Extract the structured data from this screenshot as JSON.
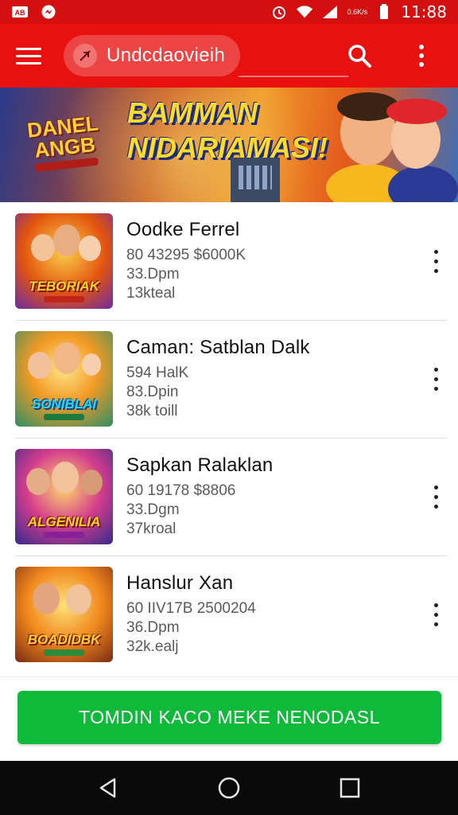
{
  "status_bar": {
    "left_icons": [
      "ab-icon",
      "messenger-icon"
    ],
    "right_icons": [
      "alarm-icon",
      "wifi-icon",
      "signal-icon",
      "data-speed-icon",
      "battery-icon"
    ],
    "data_speed_text": "0.6K/s",
    "time": "11:88"
  },
  "app_bar": {
    "search_text": "Undcdaovieih",
    "icons": [
      "menu-icon",
      "send-icon",
      "search-icon",
      "more-vertical-icon"
    ]
  },
  "banner": {
    "logo_text": "DANEL ANGB",
    "headline_line1": "BAMMAN",
    "headline_line2": "NIDARIAMASI!"
  },
  "items": [
    {
      "title": "Oodke Ferrel",
      "line1": "80 43295 $6000K",
      "line2": "33.Dpm",
      "line3": "13kteal",
      "thumb_label": "TEBORIAK"
    },
    {
      "title": "Caman: Satblan Dalk",
      "line1": "594 HalK",
      "line2": "83.Dpin",
      "line3": "38k toill",
      "thumb_label": "SONIBLAI"
    },
    {
      "title": "Sapkan Ralaklan",
      "line1": "60 19178 $8806",
      "line2": "33.Dgm",
      "line3": "37kroal",
      "thumb_label": "ALGENILIA"
    },
    {
      "title": "Hanslur Xan",
      "line1": "60 IIV17B 2500204",
      "line2": "36.Dpm",
      "line3": "32k.ealj",
      "thumb_label": "BOADIDBK"
    }
  ],
  "cta_label": "TOMDIN KACO MEKE NENODASL",
  "nav_bar": {
    "icons": [
      "back-icon",
      "home-icon",
      "recents-icon"
    ]
  },
  "colors": {
    "app_bar": "#e8110f",
    "status_bar": "#d40f0f",
    "cta": "#0fba3b",
    "nav_bar": "#0a0a0a"
  }
}
